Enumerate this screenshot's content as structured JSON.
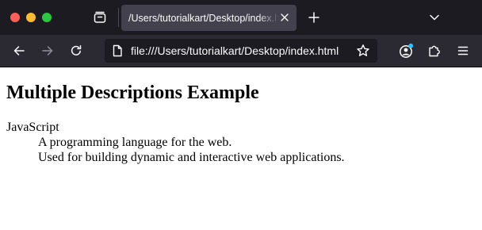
{
  "browser": {
    "tab": {
      "title": "/Users/tutorialkart/Desktop/index.html"
    },
    "url": "file:///Users/tutorialkart/Desktop/index.html",
    "colors": {
      "titlebar": "#1c1b22",
      "toolbar": "#2b2a33",
      "active_tab": "#42414d",
      "urlbar": "#1c1b22",
      "icon": "#fbfbfe",
      "notification_dot": "#2ac3ff"
    },
    "icons": {
      "window_close": "red-traffic-light",
      "window_minimize": "yellow-traffic-light",
      "window_zoom": "green-traffic-light",
      "tab_list": "firefox-view-icon",
      "tab_close": "close-icon",
      "new_tab": "plus-icon",
      "list_all_tabs": "chevron-down-icon",
      "back": "back-arrow-icon",
      "forward": "forward-arrow-icon",
      "reload": "reload-icon",
      "page": "page-icon",
      "bookmark": "star-icon",
      "account": "account-icon",
      "extensions": "puzzle-icon",
      "menu": "hamburger-menu-icon"
    }
  },
  "page": {
    "heading": "Multiple Descriptions Example",
    "definitions": [
      {
        "term": "JavaScript",
        "descriptions": [
          "A programming language for the web.",
          "Used for building dynamic and interactive web applications."
        ]
      }
    ]
  }
}
